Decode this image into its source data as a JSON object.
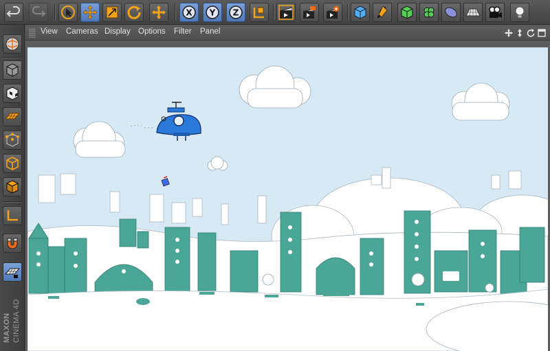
{
  "toolbar": {
    "icons": [
      "undo-icon",
      "redo-icon",
      "select-arrow-icon",
      "move-icon",
      "scale-icon",
      "rotate-icon",
      "add-move-icon",
      "x-axis-icon",
      "y-axis-icon",
      "z-axis-icon",
      "coordinate-system-icon",
      "render-view-icon",
      "render-picture-viewer-icon",
      "render-settings-icon",
      "cube-primitive-icon",
      "spline-pen-icon",
      "subdivision-icon",
      "cloner-icon",
      "deformer-icon",
      "floor-icon",
      "camera-icon",
      "light-icon"
    ],
    "axis_labels": {
      "x": "X",
      "y": "Y",
      "z": "Z"
    }
  },
  "sidebar": {
    "icons": [
      "object-model-icon",
      "model-mode-icon",
      "texture-mode-icon",
      "workplane-icon",
      "points-mode-icon",
      "edges-mode-icon",
      "polygons-mode-icon",
      "axis-mode-icon",
      "magnet-icon",
      "snap-grid-icon"
    ],
    "brand_top": "MAXON",
    "brand_bottom": "CINEMA 4D"
  },
  "viewport": {
    "menu": [
      "View",
      "Cameras",
      "Display",
      "Options",
      "Filter",
      "Panel"
    ],
    "nav_icons": [
      "pan-icon",
      "dolly-icon",
      "rotate-view-icon",
      "maximize-icon"
    ]
  },
  "colors": {
    "accent": "#f3a21a",
    "axis_blue": "#4f78b8",
    "sky": "#d8e9f6",
    "building_teal": "#4aa696",
    "snow": "#ffffff",
    "airship_blue": "#2a78d8"
  }
}
